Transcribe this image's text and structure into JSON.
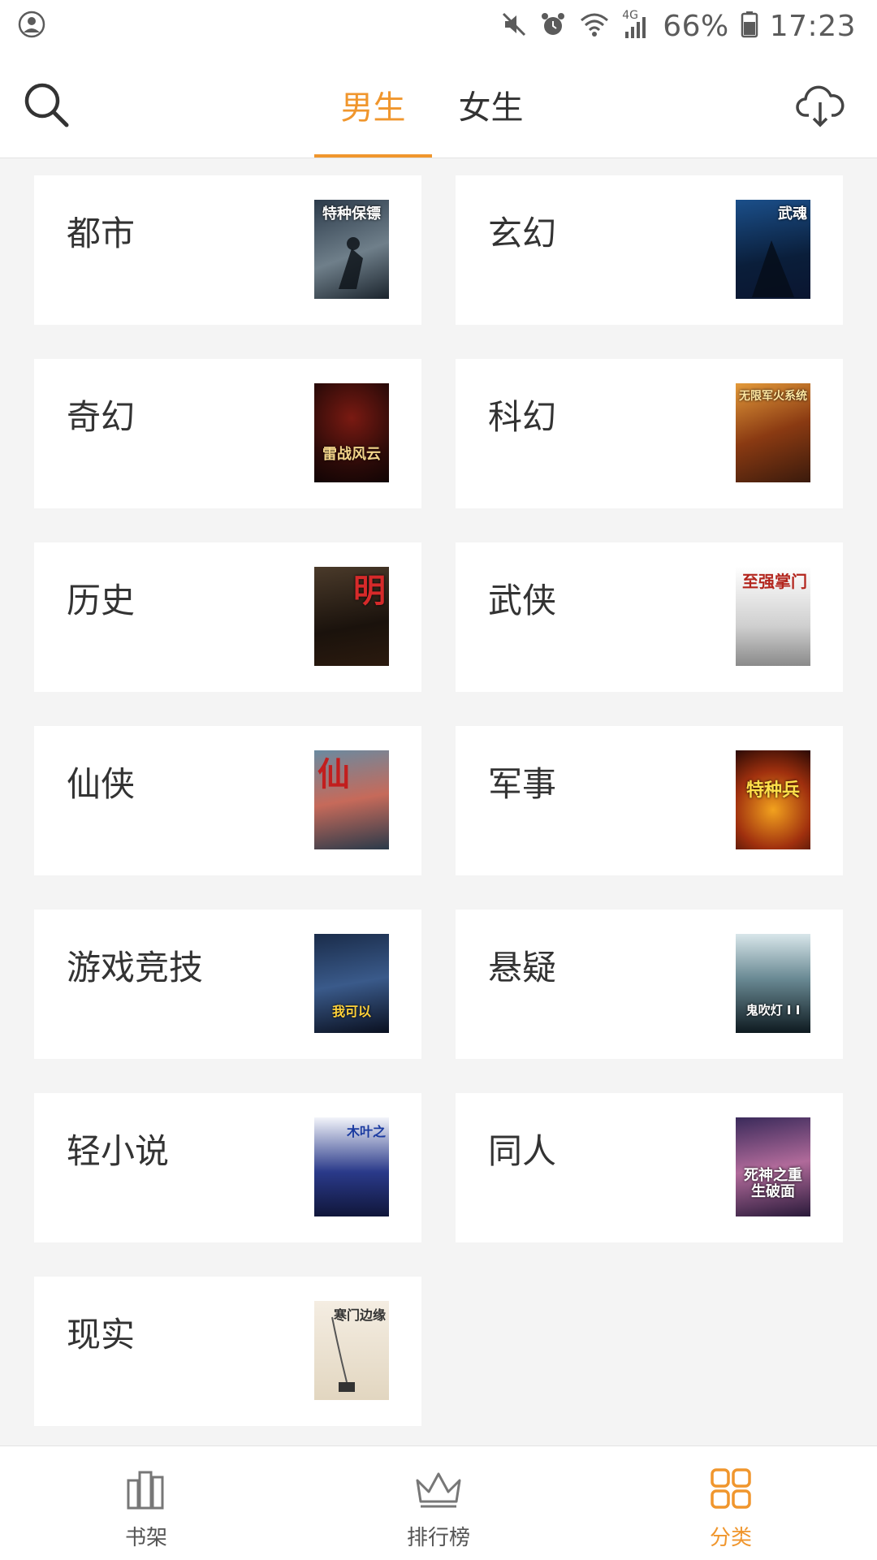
{
  "status": {
    "battery": "66%",
    "time": "17:23",
    "network": "4G",
    "icons": [
      "account-icon",
      "mute-icon",
      "alarm-icon",
      "wifi-icon",
      "signal-icon",
      "battery-icon"
    ]
  },
  "header": {
    "search_icon": "search-icon",
    "download_icon": "cloud-download-icon",
    "tabs": [
      {
        "label": "男生",
        "active": true
      },
      {
        "label": "女生",
        "active": false
      }
    ]
  },
  "categories": [
    {
      "label": "都市",
      "cover_text": "特种保镖"
    },
    {
      "label": "玄幻",
      "cover_text": "武魂"
    },
    {
      "label": "奇幻",
      "cover_text": "雷战风云"
    },
    {
      "label": "科幻",
      "cover_text": "无限军火系统"
    },
    {
      "label": "历史",
      "cover_text": "明"
    },
    {
      "label": "武侠",
      "cover_text": "至强掌门"
    },
    {
      "label": "仙侠",
      "cover_text": "仙"
    },
    {
      "label": "军事",
      "cover_text": "特种兵"
    },
    {
      "label": "游戏竞技",
      "cover_text": "我可以"
    },
    {
      "label": "悬疑",
      "cover_text": "鬼吹灯 I I"
    },
    {
      "label": "轻小说",
      "cover_text": "木叶之"
    },
    {
      "label": "同人",
      "cover_text": "死神之重生破面"
    },
    {
      "label": "现实",
      "cover_text": "寒门边缘"
    }
  ],
  "bottom_nav": [
    {
      "label": "书架",
      "icon": "bookshelf-icon",
      "active": false
    },
    {
      "label": "排行榜",
      "icon": "crown-icon",
      "active": false
    },
    {
      "label": "分类",
      "icon": "category-grid-icon",
      "active": true
    }
  ],
  "colors": {
    "accent": "#f0962d",
    "text": "#333333",
    "background": "#f4f4f4"
  }
}
